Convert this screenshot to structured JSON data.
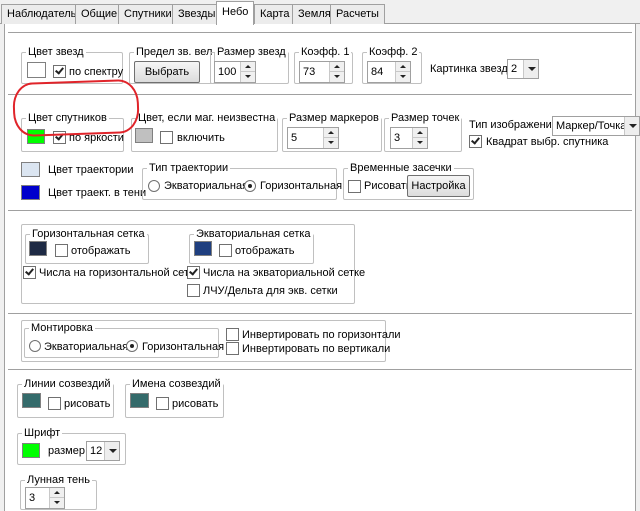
{
  "tabs": [
    "Наблюдатель",
    "Общие",
    "Спутники",
    "Звезды",
    "Небо",
    "Карта",
    "Земля",
    "Расчеты"
  ],
  "active_tab": "Небо",
  "colors": {
    "star_color": "#ffffff",
    "satellite_color": "#00ff00",
    "unknown_mag_color": "#c0c0c0",
    "trajectory_color": "#dbe5f1",
    "trajectory_shadow_color": "#0000cc",
    "horizontal_grid_color": "#1e2a44",
    "equatorial_grid_color": "#1f3f7f",
    "constellation_lines_color": "#346b6b",
    "constellation_names_color": "#346b6b",
    "font_color": "#00ff00",
    "annotation_circle": "#e0242a"
  },
  "star_color": {
    "legend": "Цвет звезд",
    "by_spectrum_label": "по спектру",
    "by_spectrum_checked": true
  },
  "star_limit": {
    "legend": "Предел зв. вел",
    "button_label": "Выбрать"
  },
  "star_size": {
    "legend": "Размер звезд",
    "value": "100"
  },
  "coef1": {
    "legend": "Коэфф. 1",
    "value": "73"
  },
  "coef2": {
    "legend": "Коэфф. 2",
    "value": "84"
  },
  "star_picture": {
    "label": "Картинка звезд",
    "value": "2"
  },
  "satellite_color": {
    "legend": "Цвет спутников",
    "by_brightness_label": "по яркости",
    "by_brightness_checked": true
  },
  "unknown_mag": {
    "legend": "Цвет, если маг. неизвестна",
    "enable_label": "включить",
    "enable_checked": false
  },
  "marker_size": {
    "legend": "Размер маркеров",
    "value": "5"
  },
  "point_size": {
    "legend": "Размер точек",
    "value": "3"
  },
  "image_type": {
    "label": "Тип изображения",
    "value": "Маркер/Точка"
  },
  "sat_square": {
    "label": "Квадрат выбр. спутника",
    "checked": true
  },
  "trajectory": {
    "color_label": "Цвет траектории",
    "shadow_label": "Цвет траект. в тени"
  },
  "trajectory_type": {
    "legend": "Тип траектории",
    "equatorial_label": "Экваториальная",
    "horizontal_label": "Горизонтальная",
    "selected": "horizontal"
  },
  "time_ticks": {
    "legend": "Временные засечки",
    "draw_label": "Рисовать",
    "draw_checked": false,
    "settings_label": "Настройка"
  },
  "horizontal_grid": {
    "legend": "Горизонтальная сетка",
    "show_label": "отображать",
    "show_checked": false,
    "numbers_label": "Числа на горизонтальной сетке",
    "numbers_checked": true
  },
  "equatorial_grid": {
    "legend": "Экваториальная сетка",
    "show_label": "отображать",
    "show_checked": false,
    "numbers_label": "Числа на экваториальной сетке",
    "numbers_checked": true,
    "ra_dec_label": "ЛЧУ/Дельта для экв. сетки",
    "ra_dec_checked": false
  },
  "mount": {
    "legend": "Монтировка",
    "equatorial_label": "Экваториальная",
    "horizontal_label": "Горизонтальная",
    "selected": "horizontal"
  },
  "invert": {
    "horizontal_label": "Инвертировать по горизонтали",
    "horizontal_checked": false,
    "vertical_label": "Инвертировать по вертикали",
    "vertical_checked": false
  },
  "constellation_lines": {
    "legend": "Линии созвездий",
    "draw_label": "рисовать",
    "draw_checked": false
  },
  "constellation_names": {
    "legend": "Имена созвездий",
    "draw_label": "рисовать",
    "draw_checked": false
  },
  "font": {
    "legend": "Шрифт",
    "size_label": "размер",
    "size_value": "12"
  },
  "moon_shadow": {
    "legend": "Лунная тень",
    "value": "3"
  }
}
